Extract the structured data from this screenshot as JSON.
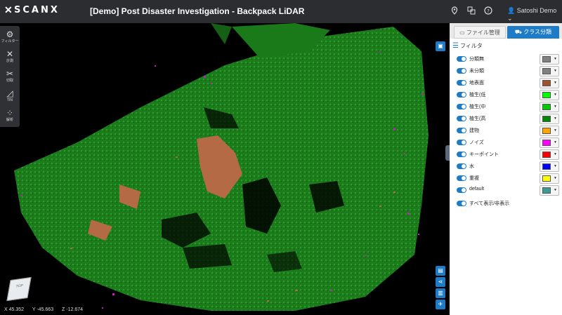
{
  "header": {
    "logo": "SCANX",
    "title": "[Demo] Post Disaster Investigation - Backpack LiDAR",
    "user": "Satoshi Demo"
  },
  "left_tools": [
    {
      "label": "フィルター",
      "icon": "filter-icon"
    },
    {
      "label": "計測",
      "icon": "measure-icon"
    },
    {
      "label": "切取",
      "icon": "clip-icon"
    },
    {
      "label": "TIN",
      "icon": "tin-icon"
    },
    {
      "label": "解析",
      "icon": "analysis-icon"
    }
  ],
  "cube": {
    "label": "TOP"
  },
  "coords": {
    "x": "X 45.352",
    "y": "Y -45.663",
    "z": "Z -12.674"
  },
  "panel": {
    "tab_file": "ファイル管理",
    "tab_class": "クラス分類",
    "filter_title": "フィルタ",
    "classes": [
      {
        "label": "分類無",
        "color": "#808080"
      },
      {
        "label": "未分類",
        "color": "#808080"
      },
      {
        "label": "地表面",
        "color": "#a0522d"
      },
      {
        "label": "植生(低",
        "color": "#00ff00"
      },
      {
        "label": "植生(中",
        "color": "#00cc00"
      },
      {
        "label": "植生(高",
        "color": "#008800"
      },
      {
        "label": "建物",
        "color": "#ffa500"
      },
      {
        "label": "ノイズ",
        "color": "#ff00ff"
      },
      {
        "label": "キーポイント",
        "color": "#ff0000"
      },
      {
        "label": "水",
        "color": "#0000ff"
      },
      {
        "label": "重複",
        "color": "#ffff00"
      },
      {
        "label": "default",
        "color": "#3a9c95"
      }
    ],
    "show_all": "すべて表示/非表示"
  },
  "colors": {
    "accent": "#1e7cc7",
    "topbar": "#2b2d30"
  }
}
